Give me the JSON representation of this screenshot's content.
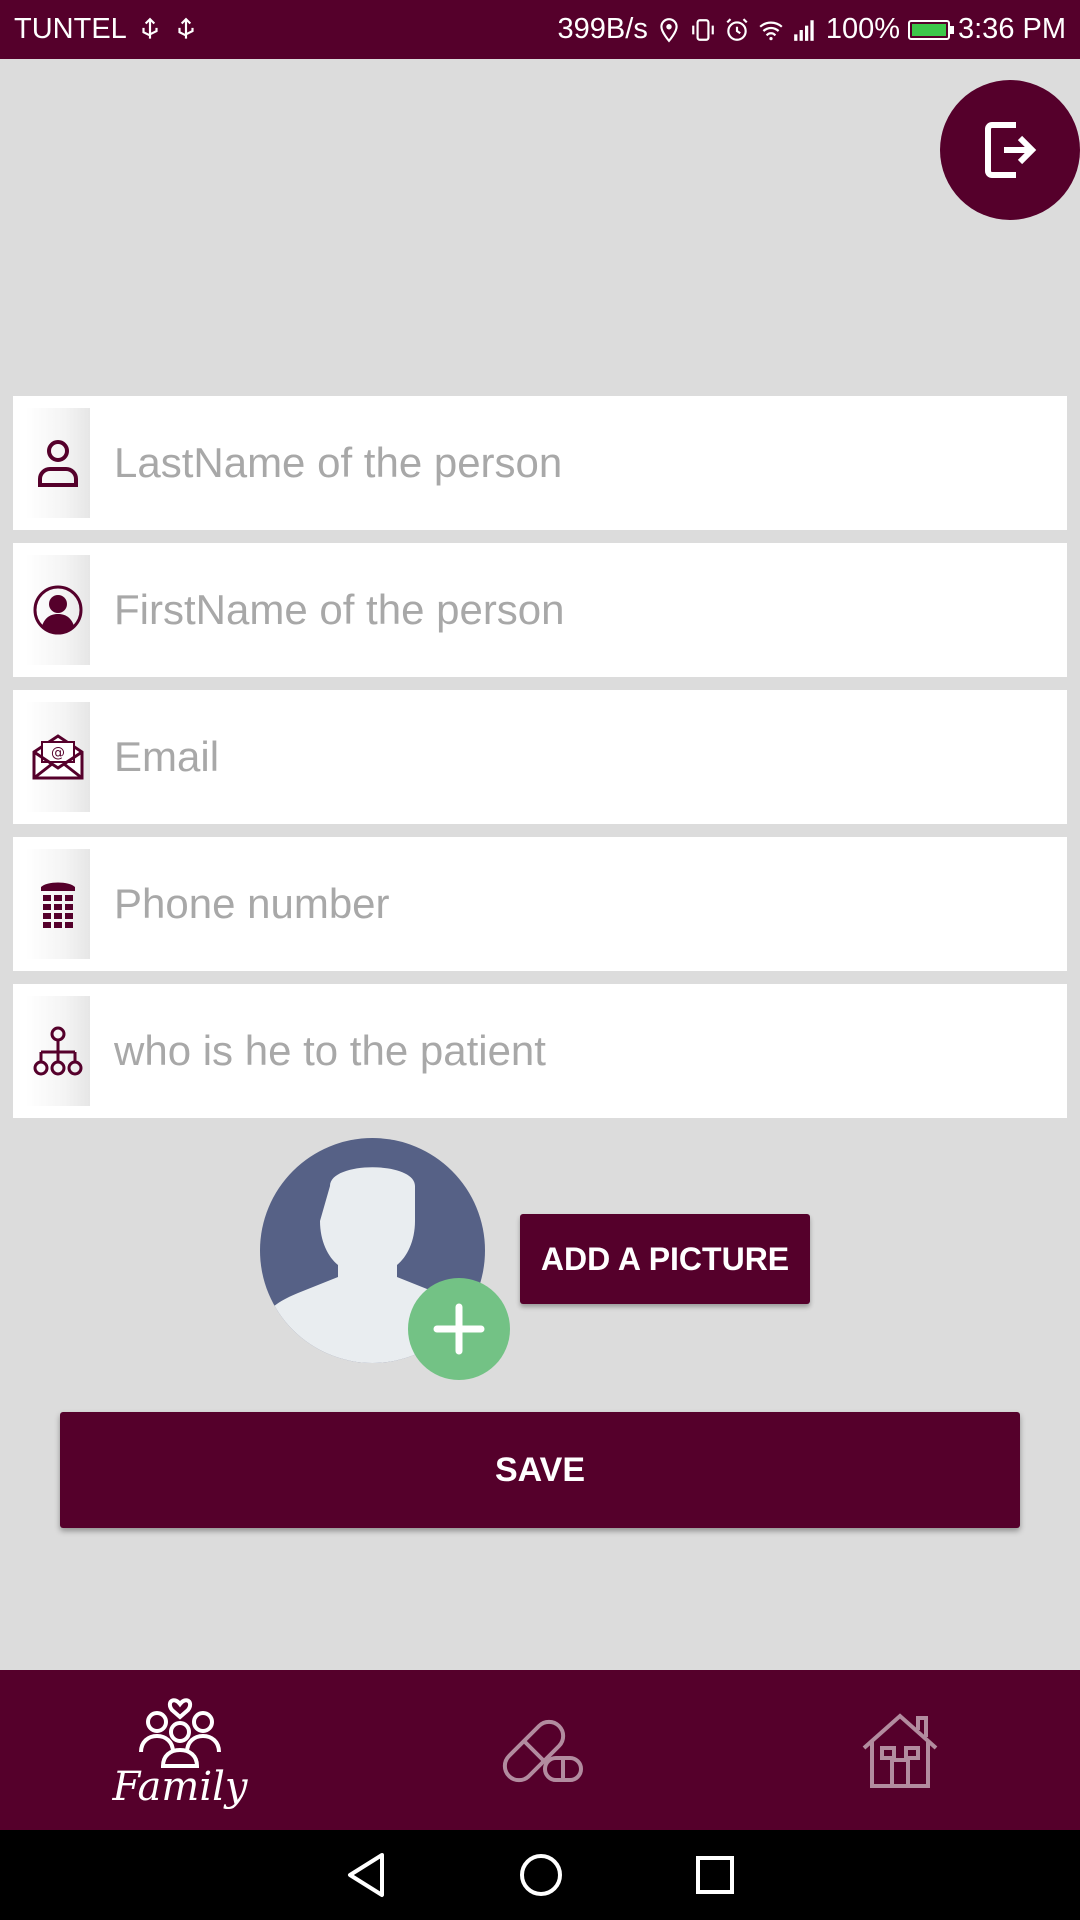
{
  "status_bar": {
    "carrier": "TUNTEL",
    "net_speed": "399B/s",
    "battery": "100%",
    "time": "3:36 PM"
  },
  "form": {
    "lastname_placeholder": "LastName of the person",
    "firstname_placeholder": "FirstName of the person",
    "email_placeholder": "Email",
    "phone_placeholder": "Phone number",
    "relation_placeholder": "who is he to the patient"
  },
  "buttons": {
    "add_picture": "ADD A PICTURE",
    "save": "SAVE"
  },
  "bottom_nav": {
    "items": [
      {
        "label": "Family",
        "icon": "family-icon",
        "active": true
      },
      {
        "label": "",
        "icon": "pill-icon",
        "active": false
      },
      {
        "label": "",
        "icon": "home-icon",
        "active": false
      }
    ]
  },
  "colors": {
    "primary": "#55002b",
    "background": "#dcdcdc",
    "avatar": "#566186",
    "add_badge": "#73c285"
  }
}
